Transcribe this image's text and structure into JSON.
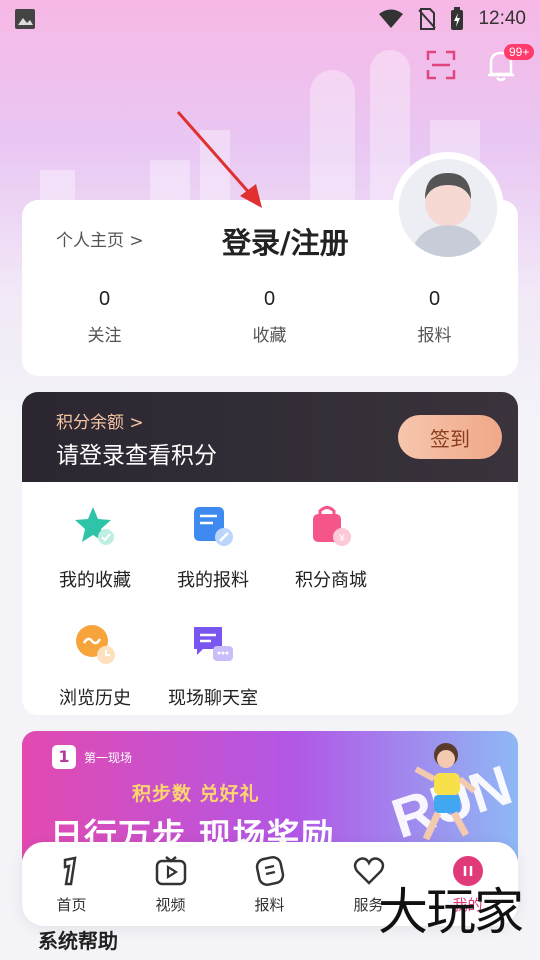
{
  "status_bar": {
    "time": "12:40",
    "icons": [
      "image-icon",
      "wifi-icon",
      "no-sim-icon",
      "battery-charging-icon"
    ]
  },
  "top": {
    "scan_icon": "scan-icon",
    "notification_icon": "bell-icon",
    "notification_badge": "99+"
  },
  "profile": {
    "home_link": "个人主页 >",
    "login_title": "登录/注册",
    "stats": [
      {
        "value": "0",
        "label": "关注"
      },
      {
        "value": "0",
        "label": "收藏"
      },
      {
        "value": "0",
        "label": "报料"
      }
    ]
  },
  "points": {
    "label": "积分余额 >",
    "prompt": "请登录查看积分",
    "sign_button": "签到"
  },
  "features": [
    {
      "label": "我的收藏",
      "icon": "star-icon"
    },
    {
      "label": "我的报料",
      "icon": "doc-edit-icon"
    },
    {
      "label": "积分商城",
      "icon": "shopping-bag-icon"
    },
    {
      "label": "浏览历史",
      "icon": "history-clock-icon"
    },
    {
      "label": "现场聊天室",
      "icon": "chat-icon"
    }
  ],
  "banner": {
    "brand": "第一现场",
    "subtitle": "积步数 兑好礼",
    "title": "日行万步 现场奖励",
    "decor_text": "RUN"
  },
  "section": {
    "title": "系统帮助"
  },
  "tabbar": [
    {
      "label": "首页",
      "icon": "home-logo-icon"
    },
    {
      "label": "视频",
      "icon": "tv-play-icon"
    },
    {
      "label": "报料",
      "icon": "report-icon"
    },
    {
      "label": "服务",
      "icon": "heart-icon"
    },
    {
      "label": "我的",
      "icon": "me-icon"
    }
  ],
  "watermark": "大玩家",
  "colors": {
    "accent": "#e03a7a",
    "points_bg": "#2b2630",
    "sign_button": "#f0a888",
    "arrow": "#e03030"
  }
}
